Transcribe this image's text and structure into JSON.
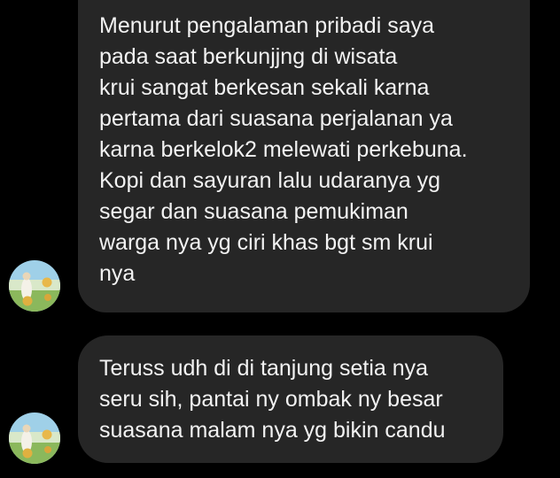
{
  "conversation": {
    "messages": [
      {
        "lines": [
          "Menurut pengalaman pribadi saya",
          "pada saat berkunjjng di wisata",
          "krui sangat berkesan sekali karna",
          "pertama dari suasana perjalanan ya",
          "karna berkelok2 melewati perkebuna.",
          "Kopi dan sayuran lalu udaranya yg",
          "segar dan suasana pemukiman",
          "warga nya yg ciri khas bgt sm krui",
          "nya"
        ]
      },
      {
        "lines": [
          "Teruss udh di di tanjung setia nya",
          "seru sih, pantai ny ombak ny besar",
          "suasana malam nya yg bikin candu"
        ]
      }
    ],
    "avatar": {
      "icon": "profile-photo-icon"
    }
  },
  "colors": {
    "background": "#000000",
    "bubble": "#262626",
    "text": "#f2f2f2"
  }
}
